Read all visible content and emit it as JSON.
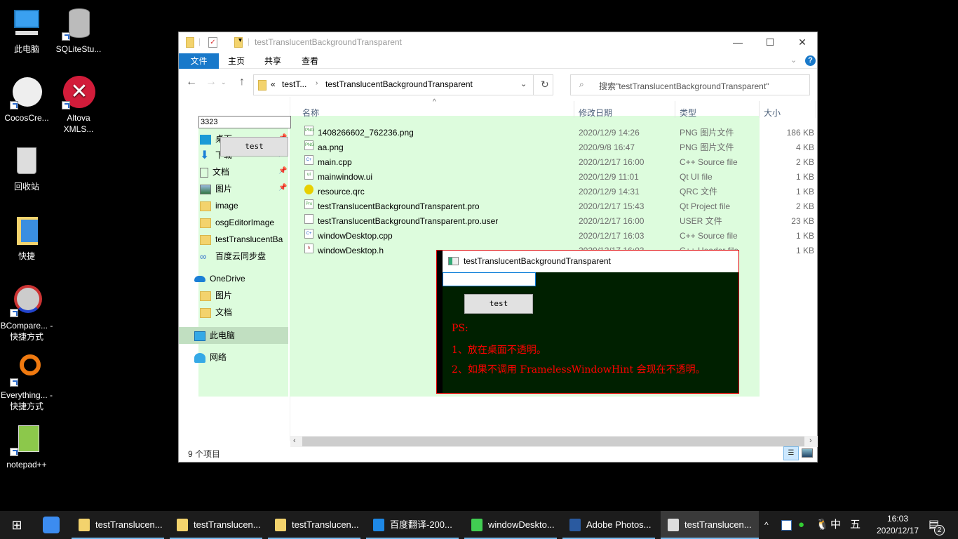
{
  "desktop": {
    "icons": [
      {
        "label": "此电脑",
        "icon": "computer-icon"
      },
      {
        "label": "SQLiteStu...",
        "icon": "database-icon"
      },
      {
        "label": "CocosCre...",
        "icon": "cocos-icon"
      },
      {
        "label": "Altova XMLS...",
        "icon": "altova-icon"
      },
      {
        "label": "回收站",
        "icon": "recycle-bin-icon"
      },
      {
        "label": "快捷",
        "icon": "folder-shortcut-icon"
      },
      {
        "label": "BCompare... - 快捷方式",
        "icon": "bcompare-icon"
      },
      {
        "label": "Everything... - 快捷方式",
        "icon": "everything-icon"
      },
      {
        "label": "notepad++",
        "icon": "notepadpp-icon"
      }
    ]
  },
  "explorer": {
    "title": "testTranslucentBackgroundTransparent",
    "ribbon_tabs": [
      "文件",
      "主页",
      "共享",
      "查看"
    ],
    "breadcrumb": {
      "prefix": "«",
      "parent": "testT...",
      "current": "testTranslucentBackgroundTransparent"
    },
    "search_placeholder": "搜索\"testTranslucentBackgroundTransparent\"",
    "nav": {
      "quick_access": [
        {
          "label": "桌面",
          "pinned": true
        },
        {
          "label": "下载",
          "pinned": true
        },
        {
          "label": "文档",
          "pinned": true
        },
        {
          "label": "图片",
          "pinned": true
        },
        {
          "label": "image",
          "pinned": false
        },
        {
          "label": "osgEditorImage",
          "pinned": false
        },
        {
          "label": "testTranslucentBa",
          "pinned": false
        },
        {
          "label": "百度云同步盘",
          "pinned": false
        }
      ],
      "onedrive": "OneDrive",
      "onedrive_items": [
        "图片",
        "文档"
      ],
      "this_pc": "此电脑",
      "network": "网络"
    },
    "columns": {
      "name": "名称",
      "date": "修改日期",
      "type": "类型",
      "size": "大小"
    },
    "files": [
      {
        "name": "1408266602_762236.png",
        "date": "2020/12/9 14:26",
        "type": "PNG 图片文件",
        "size": "186 KB",
        "icon": "png"
      },
      {
        "name": "aa.png",
        "date": "2020/9/8 16:47",
        "type": "PNG 图片文件",
        "size": "4 KB",
        "icon": "png"
      },
      {
        "name": "main.cpp",
        "date": "2020/12/17 16:00",
        "type": "C++ Source file",
        "size": "2 KB",
        "icon": "cpp"
      },
      {
        "name": "mainwindow.ui",
        "date": "2020/12/9 11:01",
        "type": "Qt UI file",
        "size": "1 KB",
        "icon": "ui"
      },
      {
        "name": "resource.qrc",
        "date": "2020/12/9 14:31",
        "type": "QRC 文件",
        "size": "1 KB",
        "icon": "qrc"
      },
      {
        "name": "testTranslucentBackgroundTransparent.pro",
        "date": "2020/12/17 15:43",
        "type": "Qt Project file",
        "size": "2 KB",
        "icon": "pro"
      },
      {
        "name": "testTranslucentBackgroundTransparent.pro.user",
        "date": "2020/12/17 16:00",
        "type": "USER 文件",
        "size": "23 KB",
        "icon": "file"
      },
      {
        "name": "windowDesktop.cpp",
        "date": "2020/12/17 16:03",
        "type": "C++ Source file",
        "size": "1 KB",
        "icon": "cpp"
      },
      {
        "name": "windowDesktop.h",
        "date": "2020/12/17 16:03",
        "type": "C++ Header file",
        "size": "1 KB",
        "icon": "h"
      }
    ],
    "status": "9 个项目"
  },
  "overlay_widget": {
    "input_value": "3323",
    "button_label": "test"
  },
  "qt_window": {
    "title": "testTranslucentBackgroundTransparent",
    "input_value": "",
    "button_label": "test",
    "lines": [
      "PS:",
      "1、放在桌面不透明。",
      "2、如果不调用 FramelessWindowHint 会现在不透明。"
    ],
    "text_color": "#ff0000",
    "bg_color": "#002000"
  },
  "taskbar": {
    "items": [
      {
        "label": "testTranslucen...",
        "icon": "folder-icon"
      },
      {
        "label": "testTranslucen...",
        "icon": "folder-icon"
      },
      {
        "label": "testTranslucen...",
        "icon": "folder-icon"
      },
      {
        "label": "百度翻译-200...",
        "icon": "browser-icon"
      },
      {
        "label": "windowDeskto...",
        "icon": "qtcreator-icon"
      },
      {
        "label": "Adobe Photos...",
        "icon": "photoshop-icon"
      },
      {
        "label": "testTranslucen...",
        "icon": "qt-app-icon"
      }
    ],
    "ime": "中",
    "ime_mode": "五",
    "time": "16:03",
    "date": "2020/12/17",
    "notifications": "2"
  }
}
